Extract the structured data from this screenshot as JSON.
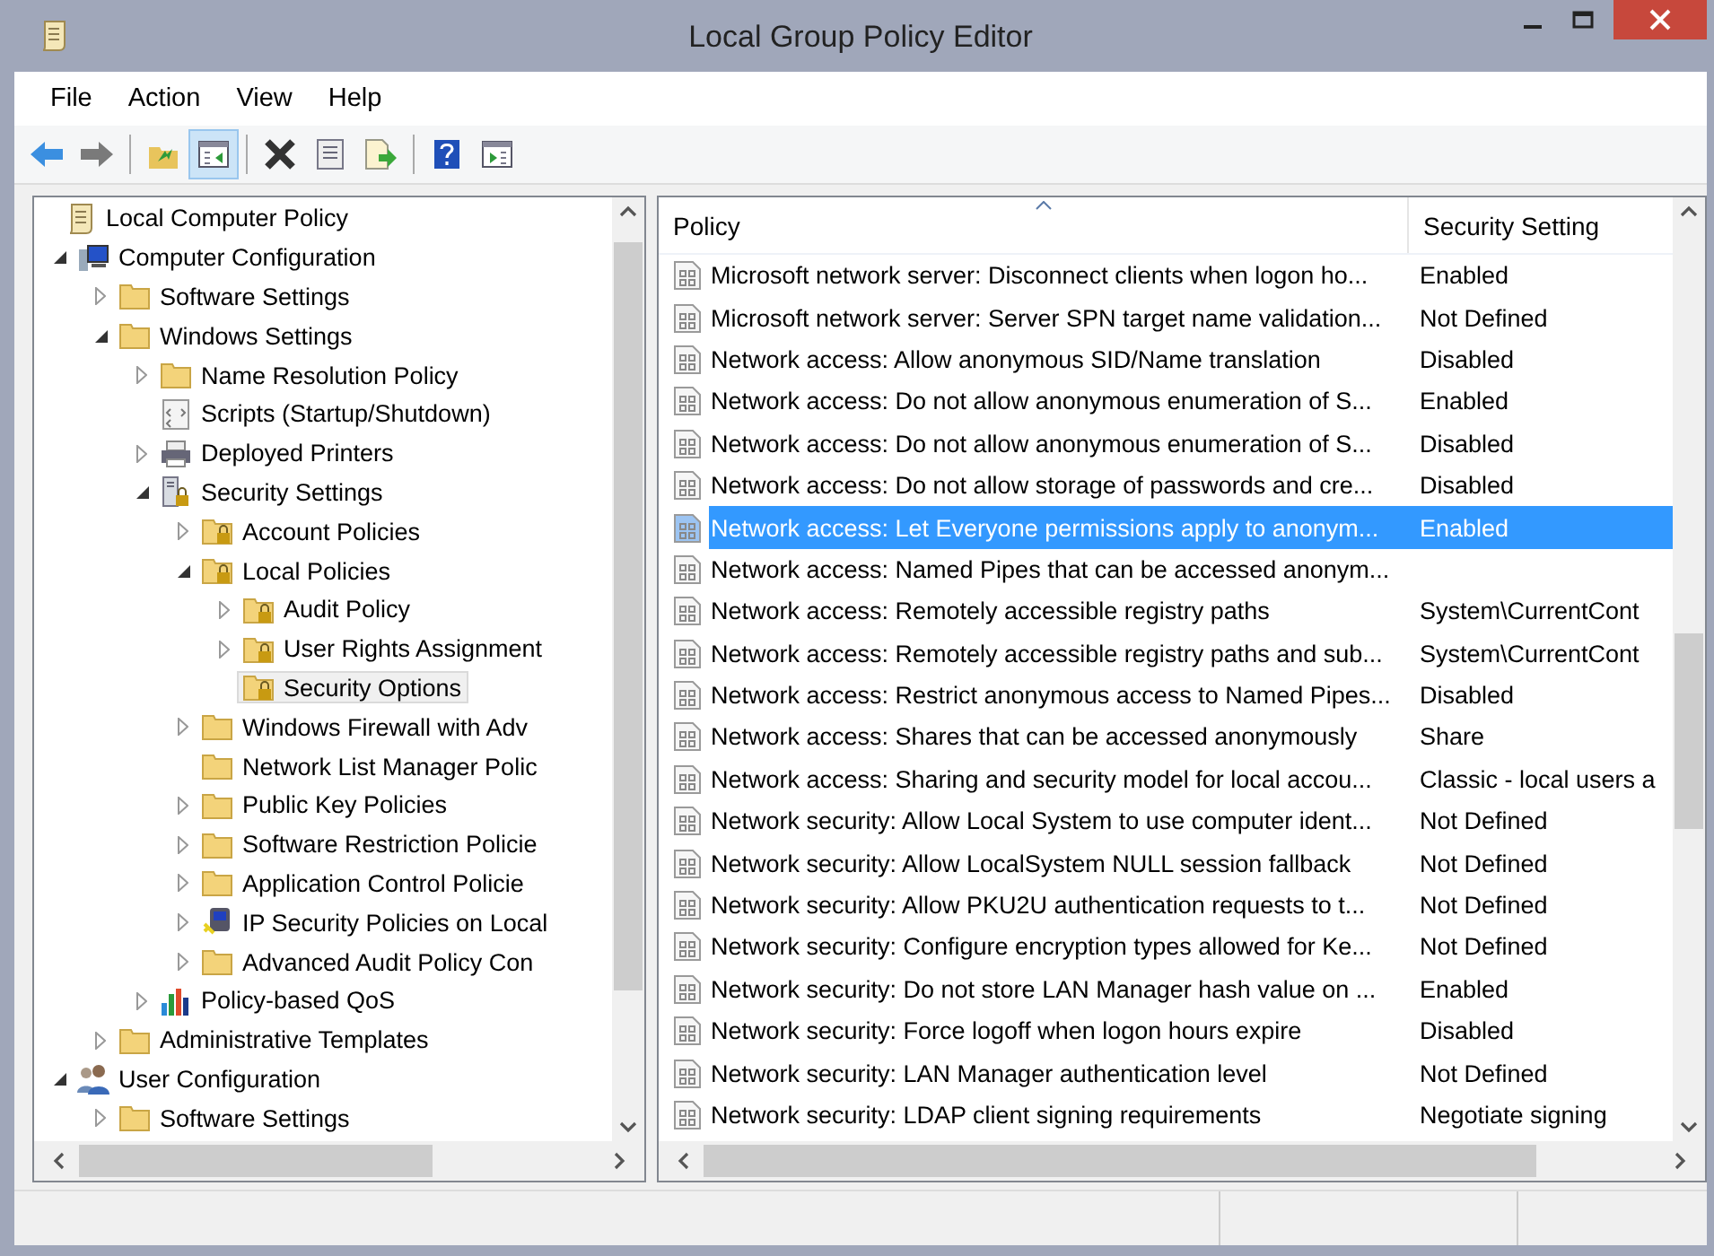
{
  "window": {
    "title": "Local Group Policy Editor"
  },
  "menu": [
    "File",
    "Action",
    "View",
    "Help"
  ],
  "toolbar": [
    {
      "kind": "back"
    },
    {
      "kind": "forward"
    },
    {
      "kind": "sep"
    },
    {
      "kind": "up",
      "selected": false
    },
    {
      "kind": "pane",
      "selected": true
    },
    {
      "kind": "sep"
    },
    {
      "kind": "delete"
    },
    {
      "kind": "properties"
    },
    {
      "kind": "export"
    },
    {
      "kind": "sep"
    },
    {
      "kind": "help"
    },
    {
      "kind": "view"
    }
  ],
  "tree": [
    {
      "label": "Local Computer Policy",
      "kind": "scroll",
      "selected": false,
      "children": [
        {
          "label": "Computer Configuration",
          "kind": "computer",
          "expanded": true,
          "selected": false,
          "children": [
            {
              "label": "Software Settings",
              "kind": "folder",
              "expanded": false,
              "selected": false
            },
            {
              "label": "Windows Settings",
              "kind": "folder",
              "expanded": true,
              "selected": false,
              "children": [
                {
                  "label": "Name Resolution Policy",
                  "kind": "folder",
                  "expanded": false,
                  "selected": false
                },
                {
                  "label": "Scripts (Startup/Shutdown)",
                  "kind": "script",
                  "selected": false
                },
                {
                  "label": "Deployed Printers",
                  "kind": "printer",
                  "expanded": false,
                  "selected": false
                },
                {
                  "label": "Security Settings",
                  "kind": "server",
                  "expanded": true,
                  "selected": false,
                  "children": [
                    {
                      "label": "Account Policies",
                      "kind": "lockfolder",
                      "expanded": false,
                      "selected": false
                    },
                    {
                      "label": "Local Policies",
                      "kind": "lockfolder",
                      "expanded": true,
                      "selected": false,
                      "children": [
                        {
                          "label": "Audit Policy",
                          "kind": "lockfolder",
                          "expanded": false,
                          "selected": false
                        },
                        {
                          "label": "User Rights Assignment",
                          "kind": "lockfolder",
                          "expanded": false,
                          "selected": false
                        },
                        {
                          "label": "Security Options",
                          "kind": "lockfolder",
                          "selected": true
                        }
                      ]
                    },
                    {
                      "label": "Windows Firewall with Adv",
                      "kind": "folder",
                      "expanded": false,
                      "selected": false
                    },
                    {
                      "label": "Network List Manager Polic",
                      "kind": "folder",
                      "selected": false
                    },
                    {
                      "label": "Public Key Policies",
                      "kind": "folder",
                      "expanded": false,
                      "selected": false
                    },
                    {
                      "label": "Software Restriction Policie",
                      "kind": "folder",
                      "expanded": false,
                      "selected": false
                    },
                    {
                      "label": "Application Control Policie",
                      "kind": "folder",
                      "expanded": false,
                      "selected": false
                    },
                    {
                      "label": "IP Security Policies on Local",
                      "kind": "ipsec",
                      "expanded": false,
                      "selected": false
                    },
                    {
                      "label": "Advanced Audit Policy Con",
                      "kind": "folder",
                      "expanded": false,
                      "selected": false
                    }
                  ]
                },
                {
                  "label": "Policy-based QoS",
                  "kind": "chart",
                  "expanded": false,
                  "selected": false
                }
              ]
            },
            {
              "label": "Administrative Templates",
              "kind": "folder",
              "expanded": false,
              "selected": false
            }
          ]
        },
        {
          "label": "User Configuration",
          "kind": "users",
          "expanded": true,
          "selected": false,
          "children": [
            {
              "label": "Software Settings",
              "kind": "folder",
              "expanded": false,
              "selected": false
            }
          ]
        }
      ]
    }
  ],
  "table": {
    "columns": [
      "Policy",
      "Security Setting"
    ],
    "rows": [
      {
        "policy": "Microsoft network server: Disconnect clients when logon ho...",
        "setting": "Enabled",
        "selected": false
      },
      {
        "policy": "Microsoft network server: Server SPN target name validation...",
        "setting": "Not Defined",
        "selected": false
      },
      {
        "policy": "Network access: Allow anonymous SID/Name translation",
        "setting": "Disabled",
        "selected": false
      },
      {
        "policy": "Network access: Do not allow anonymous enumeration of S...",
        "setting": "Enabled",
        "selected": false
      },
      {
        "policy": "Network access: Do not allow anonymous enumeration of S...",
        "setting": "Disabled",
        "selected": false
      },
      {
        "policy": "Network access: Do not allow storage of passwords and cre...",
        "setting": "Disabled",
        "selected": false
      },
      {
        "policy": "Network access: Let Everyone permissions apply to anonym...",
        "setting": "Enabled",
        "selected": true
      },
      {
        "policy": "Network access: Named Pipes that can be accessed anonym...",
        "selected": false
      },
      {
        "policy": "Network access: Remotely accessible registry paths",
        "setting": "System\\CurrentCont",
        "selected": false
      },
      {
        "policy": "Network access: Remotely accessible registry paths and sub...",
        "setting": "System\\CurrentCont",
        "selected": false
      },
      {
        "policy": "Network access: Restrict anonymous access to Named Pipes...",
        "setting": "Disabled",
        "selected": false
      },
      {
        "policy": "Network access: Shares that can be accessed anonymously",
        "setting": "Share",
        "selected": false
      },
      {
        "policy": "Network access: Sharing and security model for local accou...",
        "setting": "Classic - local users a",
        "selected": false
      },
      {
        "policy": "Network security: Allow Local System to use computer ident...",
        "setting": "Not Defined",
        "selected": false
      },
      {
        "policy": "Network security: Allow LocalSystem NULL session fallback",
        "setting": "Not Defined",
        "selected": false
      },
      {
        "policy": "Network security: Allow PKU2U authentication requests to t...",
        "setting": "Not Defined",
        "selected": false
      },
      {
        "policy": "Network security: Configure encryption types allowed for Ke...",
        "setting": "Not Defined",
        "selected": false
      },
      {
        "policy": "Network security: Do not store LAN Manager hash value on ...",
        "setting": "Enabled",
        "selected": false
      },
      {
        "policy": "Network security: Force logoff when logon hours expire",
        "setting": "Disabled",
        "selected": false
      },
      {
        "policy": "Network security: LAN Manager authentication level",
        "setting": "Not Defined",
        "selected": false
      },
      {
        "policy": "Network security: LDAP client signing requirements",
        "setting": "Negotiate signing",
        "selected": false
      }
    ]
  }
}
